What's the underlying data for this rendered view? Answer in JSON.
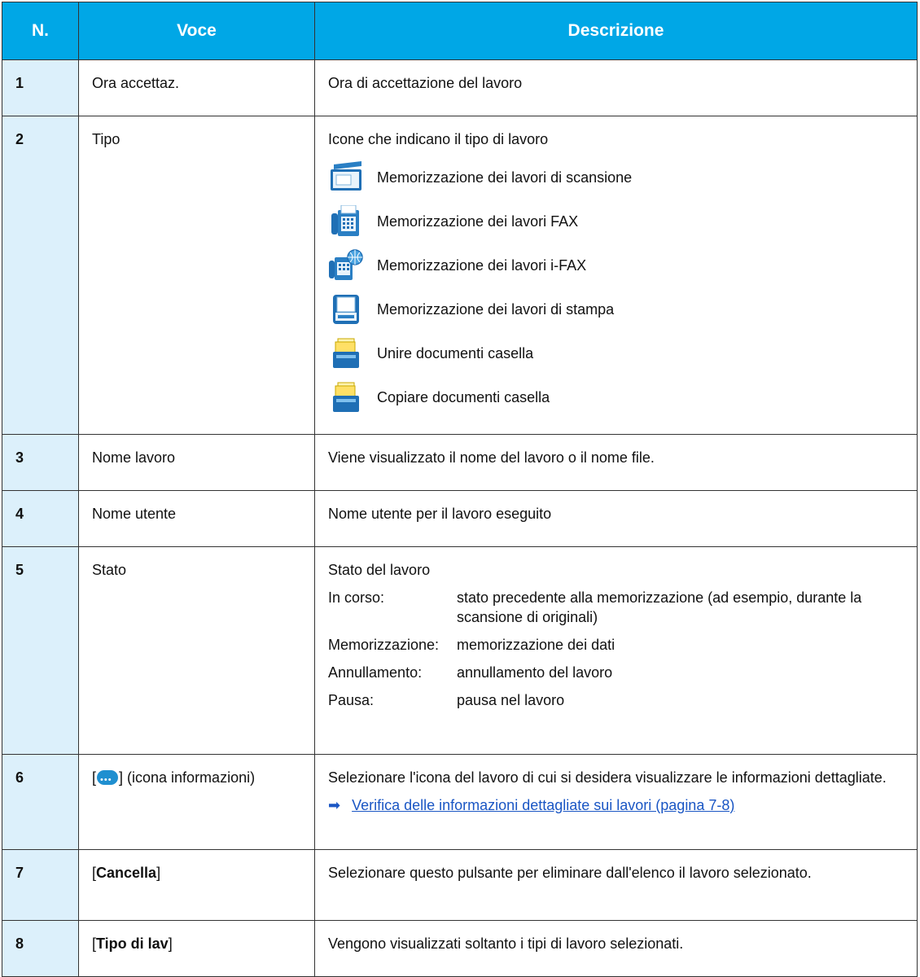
{
  "header": {
    "col1": "N.",
    "col2": "Voce",
    "col3": "Descrizione"
  },
  "rows": [
    {
      "num": "1",
      "voce": "Ora accettaz.",
      "desc": "Ora di accettazione del lavoro"
    },
    {
      "num": "2",
      "voce": "Tipo",
      "desc": "Icone che indicano il tipo di lavoro",
      "icons": [
        {
          "icon": "scanner-icon",
          "label": "Memorizzazione dei lavori di scansione"
        },
        {
          "icon": "fax-icon",
          "label": "Memorizzazione dei lavori FAX"
        },
        {
          "icon": "ifax-icon",
          "label": "Memorizzazione dei lavori i-FAX"
        },
        {
          "icon": "printer-icon",
          "label": "Memorizzazione dei lavori di stampa"
        },
        {
          "icon": "document-box-icon",
          "label": "Unire documenti casella"
        },
        {
          "icon": "document-box-icon",
          "label": "Copiare documenti casella"
        }
      ]
    },
    {
      "num": "3",
      "voce": "Nome lavoro",
      "desc": "Viene visualizzato il nome del lavoro o il nome file."
    },
    {
      "num": "4",
      "voce": "Nome utente",
      "desc": "Nome utente per il lavoro eseguito"
    },
    {
      "num": "5",
      "voce": "Stato",
      "desc": "Stato del lavoro",
      "states": [
        {
          "key": "In corso:",
          "value": "stato precedente alla memorizzazione (ad esempio, durante la scansione di originali)"
        },
        {
          "key": "Memorizzazione:",
          "value": "memorizzazione dei dati"
        },
        {
          "key": "Annullamento:",
          "value": "annullamento del lavoro"
        },
        {
          "key": "Pausa:",
          "value": "pausa nel lavoro"
        }
      ]
    },
    {
      "num": "6",
      "voce_prefix": "[",
      "voce_suffix": "] (icona informazioni)",
      "desc": "Selezionare l'icona del lavoro di cui si desidera visualizzare le informazioni dettagliate.",
      "link": "Verifica delle informazioni dettagliate sui lavori (pagina 7-8)"
    },
    {
      "num": "7",
      "voce_prefix": "[",
      "voce_bold": "Cancella",
      "voce_suffix": "]",
      "desc": "Selezionare questo pulsante per eliminare dall'elenco il lavoro selezionato."
    },
    {
      "num": "8",
      "voce_prefix": "[",
      "voce_bold": "Tipo di lav",
      "voce_suffix": "]",
      "desc": "Vengono visualizzati soltanto i tipi di lavoro selezionati."
    }
  ],
  "colors": {
    "header_bg": "#00a7e6",
    "num_bg": "#dcf0fb",
    "link": "#1a56c4"
  }
}
